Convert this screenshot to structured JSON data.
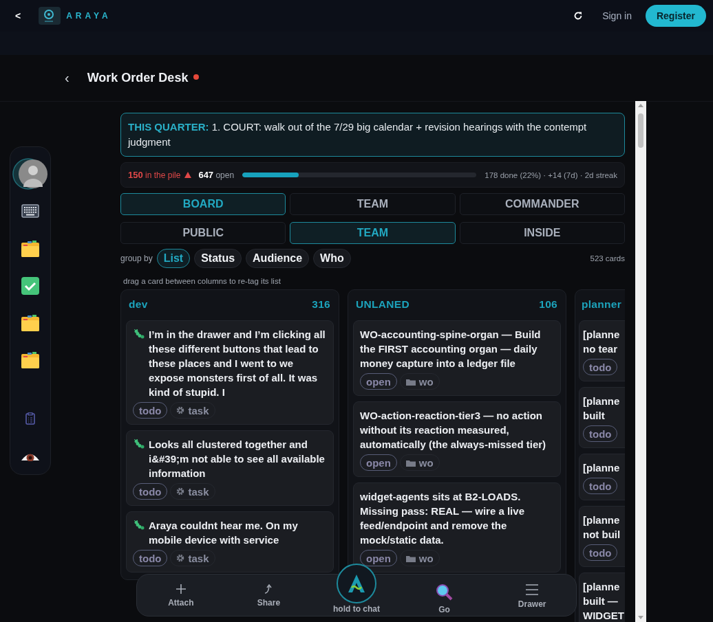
{
  "topbar": {
    "back": "<",
    "brand": "ARAYA",
    "signin": "Sign in",
    "register": "Register"
  },
  "header": {
    "back": "‹",
    "title": "Work Order Desk",
    "live": true
  },
  "sidebar": {
    "items": [
      {
        "kind": "avatar"
      },
      {
        "kind": "keyboard"
      },
      {
        "kind": "folder"
      },
      {
        "kind": "check"
      },
      {
        "kind": "folder"
      },
      {
        "kind": "folder"
      },
      {
        "kind": "clipboard"
      },
      {
        "kind": "eye"
      }
    ]
  },
  "quarter": {
    "label": "THIS QUARTER:",
    "text": "1. COURT: walk out of the 7/29 big calendar + revision hearings with the contempt judgment"
  },
  "stats": {
    "pile": "150",
    "pile_label": "in the pile",
    "open": "647",
    "open_label": "open",
    "level": 0.24,
    "summary": "178 done (22%) · +14 (7d) · 2d streak"
  },
  "views": [
    {
      "label": "BOARD",
      "selected": true
    },
    {
      "label": "TEAM",
      "selected": false
    },
    {
      "label": "COMMANDER",
      "selected": false
    }
  ],
  "audiences": [
    {
      "label": "PUBLIC",
      "selected": false
    },
    {
      "label": "TEAM",
      "selected": true
    },
    {
      "label": "INSIDE",
      "selected": false
    }
  ],
  "group_by": {
    "label": "group by",
    "options": [
      {
        "label": "List",
        "selected": true
      },
      {
        "label": "Status",
        "selected": false
      },
      {
        "label": "Audience",
        "selected": false
      },
      {
        "label": "Who",
        "selected": false
      }
    ],
    "count": "523 cards"
  },
  "hint": "drag a card between columns to re-tag its list",
  "columns": [
    {
      "name": "dev",
      "count": "316",
      "cards": [
        {
          "kind": "bug",
          "lines": [
            "I’m in the drawer and I’m clicking all these different buttons that lead to these places and I went to we expose monsters first of all. It was kind of stupid. I"
          ],
          "tags": [
            {
              "kind": "status",
              "text": "todo"
            },
            {
              "kind": "gear",
              "text": "task"
            }
          ]
        },
        {
          "kind": "bug",
          "lines": [
            "Looks all clustered together and i&#39;m not able to see all available information"
          ],
          "tags": [
            {
              "kind": "status",
              "text": "todo"
            },
            {
              "kind": "gear",
              "text": "task"
            }
          ]
        },
        {
          "kind": "bug",
          "lines": [
            "Araya couldnt hear me. On my mobile device with service"
          ],
          "tags": [
            {
              "kind": "status",
              "text": "todo"
            },
            {
              "kind": "gear",
              "text": "task"
            }
          ]
        }
      ]
    },
    {
      "name": "UNLANED",
      "count": "106",
      "cards": [
        {
          "kind": "plain",
          "lines": [
            "WO-accounting-spine-organ — Build the FIRST accounting organ — daily money capture into a ledger file"
          ],
          "tags": [
            {
              "kind": "status",
              "text": "open"
            },
            {
              "kind": "folder",
              "text": "wo"
            }
          ]
        },
        {
          "kind": "plain",
          "lines": [
            "WO-action-reaction-tier3 — no action without its reaction measured, automatically (the always-missed tier)"
          ],
          "tags": [
            {
              "kind": "status",
              "text": "open"
            },
            {
              "kind": "folder",
              "text": "wo"
            }
          ]
        },
        {
          "kind": "plain",
          "lines": [
            "widget-agents sits at B2-LOADS. Missing pass: REAL — wire a live feed/endpoint and remove the mock/static data."
          ],
          "tags": [
            {
              "kind": "status",
              "text": "open"
            },
            {
              "kind": "folder",
              "text": "wo"
            }
          ]
        }
      ]
    },
    {
      "name": "planner",
      "cards": [
        {
          "kind": "plain",
          "lines": [
            "[planne",
            "no tear"
          ],
          "tags": [
            {
              "kind": "status",
              "text": "todo"
            }
          ]
        },
        {
          "kind": "plain",
          "lines": [
            "[planne",
            "built"
          ],
          "tags": [
            {
              "kind": "status",
              "text": "todo"
            }
          ]
        },
        {
          "kind": "plain",
          "lines": [
            "[planne"
          ],
          "tags": [
            {
              "kind": "status",
              "text": "todo"
            }
          ]
        },
        {
          "kind": "plain",
          "lines": [
            "[planne",
            "not buil"
          ],
          "tags": [
            {
              "kind": "status",
              "text": "todo"
            }
          ]
        },
        {
          "kind": "plain",
          "lines": [
            "[planne",
            "built —",
            "WIDGET"
          ]
        }
      ]
    }
  ],
  "dock": [
    {
      "kind": "plus",
      "label": "Attach"
    },
    {
      "kind": "share",
      "label": "Share"
    },
    {
      "kind": "center",
      "label": "hold to chat"
    },
    {
      "kind": "search",
      "label": "Go"
    },
    {
      "kind": "menu",
      "label": "Drawer"
    }
  ]
}
